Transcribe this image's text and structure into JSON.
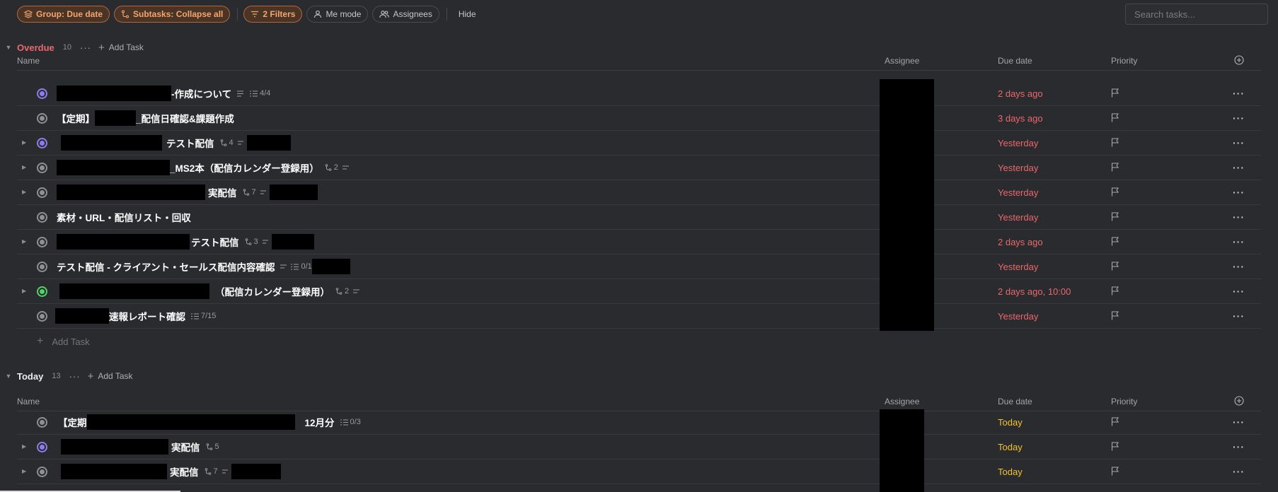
{
  "toolbar": {
    "group_label": "Group: Due date",
    "subtasks_label": "Subtasks: Collapse all",
    "filters_label": "2 Filters",
    "me_mode_label": "Me mode",
    "assignees_label": "Assignees",
    "hide_label": "Hide",
    "search_placeholder": "Search tasks..."
  },
  "columns": {
    "name": "Name",
    "assignee": "Assignee",
    "due_date": "Due date",
    "priority": "Priority"
  },
  "groups": {
    "overdue": {
      "title": "Overdue",
      "count": "10",
      "more": "···",
      "add_task": "Add Task",
      "add_task_row": "Add Task",
      "tasks": [
        {
          "suffix": "-作成について",
          "checklist": "4/4",
          "due": "2 days ago"
        },
        {
          "prefix": "【定期】",
          "suffix": "_配信日確認&課題作成",
          "due": "3 days ago"
        },
        {
          "suffix": "テスト配信",
          "subtasks": "4",
          "due": "Yesterday"
        },
        {
          "suffix": "_MS2本（配信カレンダー登録用）",
          "subtasks": "2",
          "due": "Yesterday"
        },
        {
          "suffix": "実配信",
          "subtasks": "7",
          "due": "Yesterday"
        },
        {
          "prefix": "素材・URL・配信リスト・回収",
          "due": "Yesterday"
        },
        {
          "suffix": "テスト配信",
          "subtasks": "3",
          "due": "2 days ago"
        },
        {
          "prefix": "テスト配信 - クライアント・セールス配信内容確認",
          "checklist": "0/1",
          "due": "Yesterday"
        },
        {
          "suffix": "（配信カレンダー登録用）",
          "subtasks": "2",
          "due": "2 days ago, 10:00"
        },
        {
          "suffix": "速報レポート確認",
          "checklist": "7/15",
          "due": "Yesterday"
        }
      ]
    },
    "today": {
      "title": "Today",
      "count": "13",
      "more": "···",
      "add_task": "Add Task",
      "tasks": [
        {
          "prefix": "【定期",
          "suffix": "12月分",
          "checklist": "0/3",
          "due": "Today"
        },
        {
          "suffix": "実配信",
          "subtasks": "5",
          "due": "Today"
        },
        {
          "suffix": "実配信",
          "subtasks": "7",
          "due": "Today"
        }
      ]
    }
  },
  "row_more": "···",
  "colors": {
    "accent_orange": "#f3a56f",
    "overdue_red": "#e9686d",
    "today_yellow": "#f2c230",
    "status_purple": "#8c7cf0",
    "status_green": "#4ed26a"
  },
  "icons": [
    "layers-icon",
    "subtask-icon",
    "filter-icon",
    "person-icon",
    "people-icon",
    "caret-down-icon",
    "caret-right-icon",
    "status-circle-icon",
    "flag-icon",
    "more-icon",
    "add-column-icon",
    "description-icon",
    "checklist-icon"
  ]
}
